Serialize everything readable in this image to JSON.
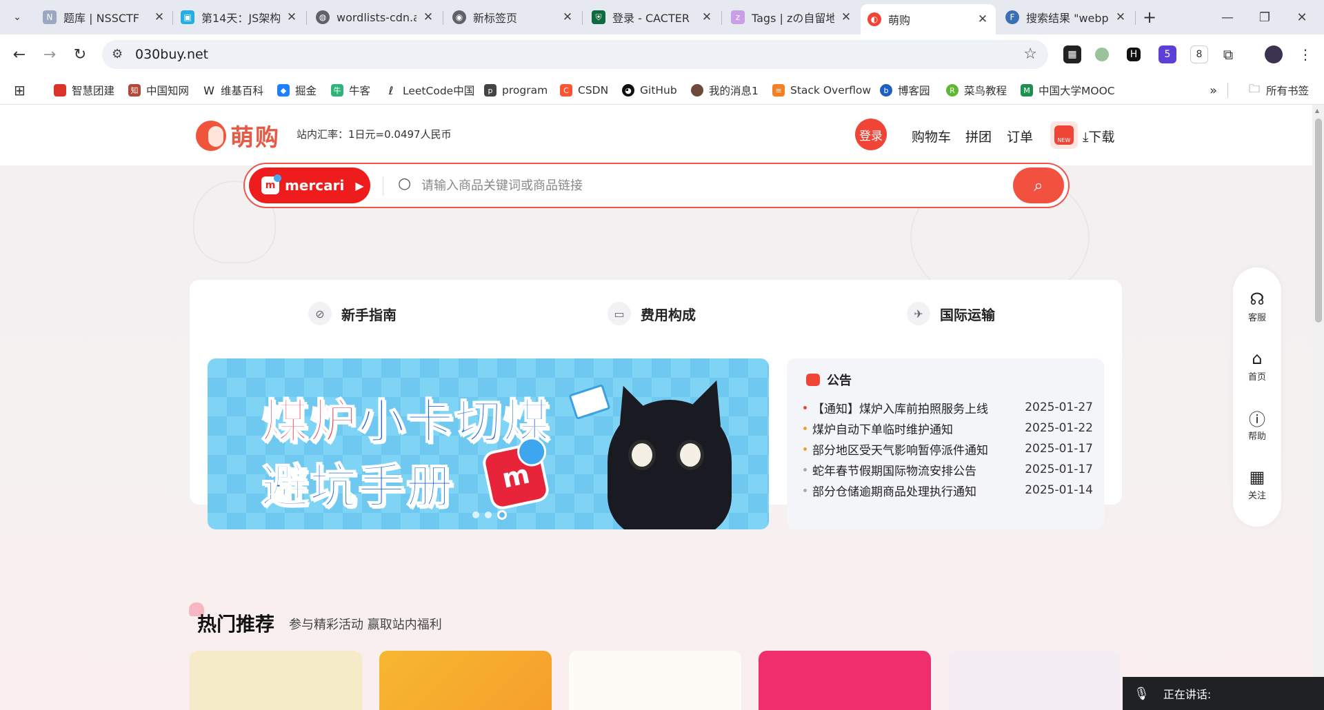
{
  "tabs": [
    {
      "title": "题库 | NSSCTF",
      "icon": "nssctf-icon",
      "color": "#9aa8c2",
      "active": false
    },
    {
      "title": "第14天：JS架构",
      "icon": "bilibili-icon",
      "color": "#23aee5",
      "active": false
    },
    {
      "title": "wordlists-cdn.a",
      "icon": "globe-icon",
      "color": "#5f6368",
      "active": false
    },
    {
      "title": "新标签页",
      "icon": "chrome-icon",
      "color": "#5f6368",
      "active": false
    },
    {
      "title": "登录 - CACTER",
      "icon": "shield-icon",
      "color": "#0e6b3f",
      "active": false
    },
    {
      "title": "Tags | zの自留地",
      "icon": "z-icon",
      "color": "#c9a0e6",
      "active": false
    },
    {
      "title": "萌购",
      "icon": "moegou-icon",
      "color": "#ef4436",
      "active": true
    },
    {
      "title": "搜索结果 \"webp",
      "icon": "search-icon",
      "color": "#3b6fb6",
      "active": false
    }
  ],
  "toolbar": {
    "url": "030buy.net"
  },
  "bookmarks": [
    {
      "label": "智慧团建",
      "color": "#d9342b"
    },
    {
      "label": "中国知网",
      "color": "#b5473a"
    },
    {
      "label": "维基百科",
      "color": "#333333"
    },
    {
      "label": "掘金",
      "color": "#1e80ff"
    },
    {
      "label": "牛客",
      "color": "#2fb37a"
    },
    {
      "label": "LeetCode中国",
      "color": "#333333"
    },
    {
      "label": "program",
      "color": "#333333"
    },
    {
      "label": "CSDN",
      "color": "#fc5531"
    },
    {
      "label": "GitHub",
      "color": "#111111"
    },
    {
      "label": "我的消息1",
      "color": "#6b4a3a"
    },
    {
      "label": "Stack Overflow",
      "color": "#f48024"
    },
    {
      "label": "博客园",
      "color": "#1d5fc7"
    },
    {
      "label": "菜鸟教程",
      "color": "#5fb832"
    },
    {
      "label": "中国大学MOOC",
      "color": "#1f8e4f"
    }
  ],
  "bookmarks_all": "所有书签",
  "header": {
    "brand": "萌购",
    "rate": "站内汇率：1日元=0.0497人民币",
    "login": "登录",
    "nav": [
      "购物车",
      "拼团",
      "订单"
    ],
    "new_badge": "NEW",
    "download": "下载"
  },
  "search": {
    "platform": "mercari",
    "placeholder": "请输入商品关键词或商品链接"
  },
  "guides": [
    {
      "label": "新手指南",
      "icon": "compass-icon"
    },
    {
      "label": "费用构成",
      "icon": "wallet-icon"
    },
    {
      "label": "国际运输",
      "icon": "plane-icon"
    }
  ],
  "banner": {
    "line1_red": "煤炉",
    "line1_blue": "小卡切煤",
    "line2": "避坑手册",
    "mark": "m"
  },
  "notice": {
    "title": "公告",
    "items": [
      {
        "text": "【通知】煤炉入库前拍照服务上线",
        "date": "2025-01-27",
        "color": "#ef4436"
      },
      {
        "text": "煤炉自动下单临时维护通知",
        "date": "2025-01-22",
        "color": "#f0a030"
      },
      {
        "text": "部分地区受天气影响暂停派件通知",
        "date": "2025-01-17",
        "color": "#f0a030"
      },
      {
        "text": "蛇年春节假期国际物流安排公告",
        "date": "2025-01-17",
        "color": "#aaaaaa"
      },
      {
        "text": "部分仓储逾期商品处理执行通知",
        "date": "2025-01-14",
        "color": "#aaaaaa"
      }
    ]
  },
  "rail": [
    {
      "label": "客服",
      "icon": "headset-icon"
    },
    {
      "label": "首页",
      "icon": "home-icon"
    },
    {
      "label": "帮助",
      "icon": "help-icon"
    },
    {
      "label": "关注",
      "icon": "qrcode-icon"
    }
  ],
  "hot": {
    "title": "热门推荐",
    "subtitle": "参与精彩活动 赢取站内福利"
  },
  "toast": {
    "text": "正在讲话:"
  }
}
